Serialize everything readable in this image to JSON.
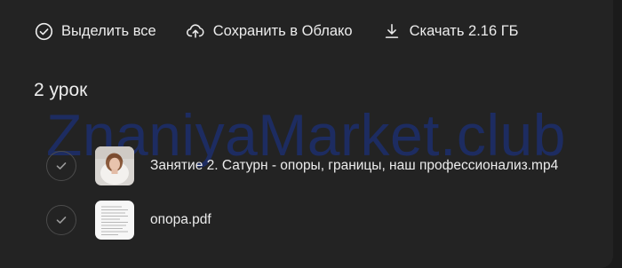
{
  "toolbar": {
    "select_all": {
      "label": "Выделить все",
      "icon": "check-circle-icon"
    },
    "save_cloud": {
      "label": "Сохранить в Облако",
      "icon": "cloud-upload-icon"
    },
    "download": {
      "label": "Скачать 2.16 ГБ",
      "icon": "download-icon"
    }
  },
  "folder": {
    "title": "2 урок"
  },
  "watermark": "ZnaniyaMarket.club",
  "files": [
    {
      "name": "Занятие 2. Сатурн - опоры, границы, наш профессионализ.mp4",
      "type": "video"
    },
    {
      "name": "опора.pdf",
      "type": "pdf"
    }
  ],
  "colors": {
    "background": "#232323",
    "text": "#ececec",
    "watermark": "#1c2e6c"
  }
}
